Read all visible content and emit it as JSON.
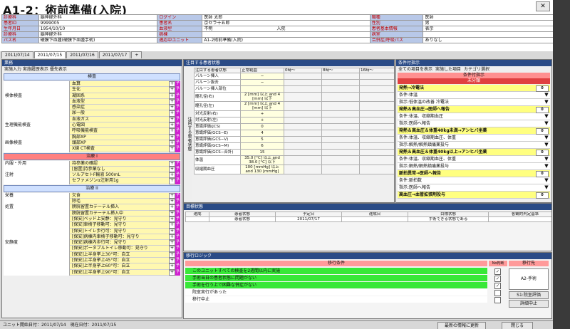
{
  "window": {
    "title": "A1-2：術前準備(入院)",
    "close_label": "✕"
  },
  "patient": {
    "rows": [
      [
        {
          "l": "診療科",
          "v": "脳神経外科"
        },
        {
          "l": "ログイン",
          "v": "医師 太郎"
        },
        {
          "l": "職種",
          "v": "医師"
        }
      ],
      [
        {
          "l": "患者ID",
          "v": "9999005"
        },
        {
          "l": "患者名",
          "v": "京セラ十五郎"
        },
        {
          "l": "性別",
          "v": "男"
        }
      ],
      [
        {
          "l": "生年月日",
          "v": "1954/10/10"
        },
        {
          "l": "血液型",
          "v": "不明",
          "extra": "入院"
        },
        {
          "l": "患者基本情報",
          "v": "表示"
        }
      ],
      [
        {
          "l": "診療科",
          "v": "脳神経外科"
        },
        {
          "l": "病棟",
          "v": ""
        },
        {
          "l": "病室",
          "v": ""
        }
      ],
      [
        {
          "l": "パス名",
          "v": "硬膜下血腫(硬膜下血腫手術)"
        },
        {
          "l": "適応中ユニット",
          "v": "A1-2術前準備(入院)"
        },
        {
          "l": "合併症/呼吸パス",
          "v": "ありなし"
        }
      ]
    ]
  },
  "tabs": [
    "2011/07/14",
    "2011/07/15",
    "2011/07/16",
    "2011/07/17",
    "+"
  ],
  "left_panel": {
    "title": "業務",
    "toolbar": "実施入力  実施履歴表示  優先表示",
    "sections": [
      {
        "name": "検査",
        "red": false,
        "rows": [
          {
            "cat": "",
            "item": "血算"
          },
          {
            "cat": "",
            "item": "生化"
          },
          {
            "cat": "検体検査",
            "item": "凝固系"
          },
          {
            "cat": "",
            "item": "血液型"
          },
          {
            "cat": "",
            "item": "感染症"
          },
          {
            "cat": "",
            "item": "尿一般"
          },
          {
            "cat": "",
            "item": "血液ガス"
          },
          {
            "cat": "生理機能検査",
            "item": "心電図"
          },
          {
            "cat": "",
            "item": "呼吸機能検査"
          },
          {
            "cat": "",
            "item": "胸部XP"
          },
          {
            "cat": "画像検査",
            "item": "頭部XP"
          },
          {
            "cat": "",
            "item": "X線 CT検査"
          }
        ]
      },
      {
        "name": "治療 I",
        "red": true,
        "rows": [
          {
            "cat": "内服・外用",
            "item": "持参薬の確認"
          },
          {
            "cat": "",
            "item": "[留置]持参薬なし"
          },
          {
            "cat": "注射",
            "item": "ソルアセトF輸液 500mL"
          },
          {
            "cat": "",
            "item": "セファメジンα注射用1g"
          }
        ]
      },
      {
        "name": "治療 II",
        "red": false,
        "rows": [
          {
            "cat": "栄養",
            "item": "欠食"
          },
          {
            "cat": "",
            "item": "除毛"
          },
          {
            "cat": "処置",
            "item": "膀胱留置カテーテル挿入"
          },
          {
            "cat": "",
            "item": "膀胱留置カテーテル挿入中"
          },
          {
            "cat": "",
            "item": "[保安]ベッド上安静：見守り"
          },
          {
            "cat": "",
            "item": "[保安]車椅子移動可：見守り"
          },
          {
            "cat": "",
            "item": "[保安]トイレ歩行可：見守り"
          },
          {
            "cat": "",
            "item": "[保安]病棟内車椅子移動可：見守り"
          },
          {
            "cat": "安静度",
            "item": "[保安]病棟内歩行可：見守り"
          },
          {
            "cat": "",
            "item": "[保安]ポータブルトイレ移動可：見守り"
          },
          {
            "cat": "",
            "item": "[保安]上半身挙上30°可：自立"
          },
          {
            "cat": "",
            "item": "[保安]上半身挙上45°可：自立"
          },
          {
            "cat": "",
            "item": "[保安]上半身挙上60°可：自立"
          },
          {
            "cat": "",
            "item": "[保安]上半身挙上90°可：自立"
          }
        ]
      }
    ]
  },
  "center_panel": {
    "title": "注目する患者状態",
    "header": [
      "注目する患者状態",
      "正常範囲",
      "0時〜",
      "8時〜",
      "16時〜"
    ],
    "side_label": "注目する患者状態",
    "rows": [
      {
        "name": "バルーン挿入",
        "norm": "−"
      },
      {
        "name": "バルーン抜去",
        "norm": "−"
      },
      {
        "name": "バルーン挿入部位",
        "norm": ""
      },
      {
        "name": "瞳孔径(右)",
        "norm": "2 [mm] 以上 and 4 [mm] 以下"
      },
      {
        "name": "瞳孔径(左)",
        "norm": "2 [mm] 以上 and 4 [mm] 以下"
      },
      {
        "name": "対光反射(右)",
        "norm": "+"
      },
      {
        "name": "対光反射(左)",
        "norm": "+"
      },
      {
        "name": "意識評価(JCS)",
        "norm": "0"
      },
      {
        "name": "意識評価(GCS−E)",
        "norm": "4"
      },
      {
        "name": "意識評価(GCS−V)",
        "norm": "5"
      },
      {
        "name": "意識評価(GCS−M)",
        "norm": "6"
      },
      {
        "name": "意識評価(GCS−合計)",
        "norm": "15"
      },
      {
        "name": "体温",
        "norm": "35.0 [°C] 以上 and 38.0 [°C] 以下"
      },
      {
        "name": "収縮期血圧",
        "norm": "100 [mmHg] 以上 and 130 [mmHg]"
      }
    ]
  },
  "right_panel": {
    "title": "条件付指示",
    "toolbar": [
      "全ての項目を表示",
      "実施した項目",
      "カテゴリ選択"
    ],
    "header": "条件付指示",
    "subheader": "未分類",
    "rows": [
      {
        "t": "発熱→冷罨法",
        "hi": true,
        "n": "0"
      },
      {
        "t": "条件:体温",
        "hi": false,
        "n": ""
      },
      {
        "t": "指示:低体温の改善 冷罨法",
        "hi": false,
        "n": ""
      },
      {
        "t": "発熱＆高血圧→医師へ報告",
        "hi": true,
        "n": "0"
      },
      {
        "t": "条件:体温、収縮期血圧",
        "hi": false,
        "n": ""
      },
      {
        "t": "指示:医師へ報告",
        "hi": false,
        "n": ""
      },
      {
        "t": "発熱＆高血圧＆体重40kg未満→アンヒバ坐薬",
        "hi": true,
        "n": "0"
      },
      {
        "t": "条件:体温、収縮期血圧、体重",
        "hi": false,
        "n": ""
      },
      {
        "t": "指示:解熱/解熱鎮痛薬投与",
        "hi": false,
        "n": ""
      },
      {
        "t": "発熱＆高血圧＆体重40kg以上→アンヒバ坐薬",
        "hi": true,
        "n": "0"
      },
      {
        "t": "条件:体温、収縮期血圧、体重",
        "hi": false,
        "n": ""
      },
      {
        "t": "指示:解熱/解熱鎮痛薬投与",
        "hi": false,
        "n": ""
      },
      {
        "t": "脈拍異常→医師へ報告",
        "hi": true,
        "n": "0"
      },
      {
        "t": "条件:脈拍数",
        "hi": false,
        "n": ""
      },
      {
        "t": "指示:医師へ報告",
        "hi": false,
        "n": ""
      },
      {
        "t": "高血圧→血管拡張剤投与",
        "hi": true,
        "n": "0"
      }
    ]
  },
  "goal_panel": {
    "title": "目標状態",
    "header": [
      "達成",
      "患者状態",
      "予定日",
      "達成日",
      "目標状態",
      "客観的判定基準"
    ],
    "row": [
      "",
      "患者状態",
      "2011/07/17",
      "",
      "手術できる状態である",
      ""
    ]
  },
  "transition_panel": {
    "title": "移行ロジック",
    "header": [
      "移行条件",
      "No判断",
      "移行先"
    ],
    "rows": [
      {
        "t": "このユニットすべての検査を2週間以内に実施",
        "green": true
      },
      {
        "t": "手術当日の患者状態に問題がない",
        "green": true
      },
      {
        "t": "手術を行う上で困難な併症がない",
        "green": true
      },
      {
        "t": "院室実行があった",
        "green": false
      },
      {
        "t": "移行中止",
        "green": false
      }
    ],
    "buttons": [
      "A2-手術",
      "S1:院室評価",
      "詳細中止"
    ]
  },
  "status": {
    "text": "ユニット開始日付：2011/07/14　現在日付：2011/07/15",
    "refresh": "最新の情報に更新",
    "close": "閉じる"
  },
  "colors": {
    "label_bg": "#b8c8e8",
    "accent": "#2a4b86",
    "green": "#38e838",
    "highlight": "#ffff80"
  }
}
